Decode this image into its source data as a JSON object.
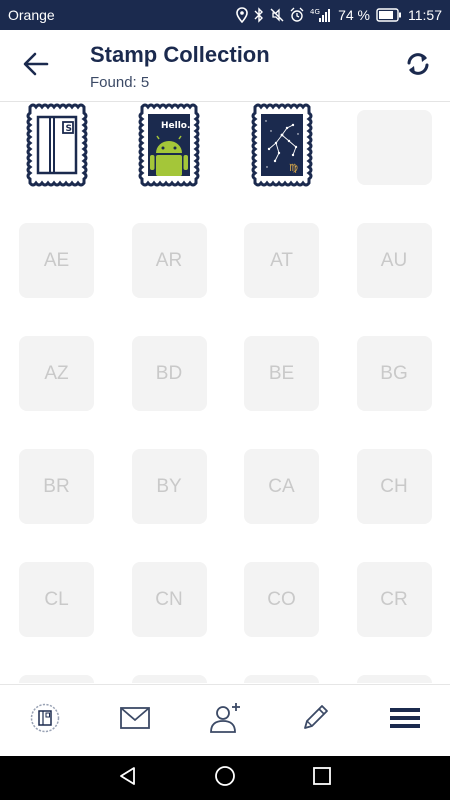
{
  "status_bar": {
    "carrier": "Orange",
    "battery": "74 %",
    "time": "11:57",
    "network": "4G",
    "icons": [
      "location-icon",
      "bluetooth-icon",
      "mute-icon",
      "alarm-icon",
      "signal-icon",
      "battery-icon"
    ]
  },
  "header": {
    "title": "Stamp Collection",
    "subtitle": "Found: 5",
    "back_icon": "arrow-left-icon",
    "refresh_icon": "refresh-icon"
  },
  "stamps_found": [
    {
      "name": "letter-stamp",
      "icon": "letter-s-icon"
    },
    {
      "name": "android-stamp",
      "icon": "android-hello-icon",
      "text": "Hello."
    },
    {
      "name": "constellation-stamp",
      "icon": "virgo-constellation-icon",
      "text": "♍"
    }
  ],
  "country_slots": [
    "AE",
    "AR",
    "AT",
    "AU",
    "AZ",
    "BD",
    "BE",
    "BG",
    "BR",
    "BY",
    "CA",
    "CH",
    "CL",
    "CN",
    "CO",
    "CR"
  ],
  "bottom_nav": [
    {
      "name": "stamps-tab",
      "icon": "stamp-icon"
    },
    {
      "name": "mail-tab",
      "icon": "envelope-icon"
    },
    {
      "name": "add-friend-tab",
      "icon": "add-user-icon"
    },
    {
      "name": "write-tab",
      "icon": "pencil-icon"
    },
    {
      "name": "menu-tab",
      "icon": "hamburger-menu-icon"
    }
  ],
  "colors": {
    "primary": "#1b2a4e",
    "android_green": "#a4c639",
    "slot_bg": "#f3f3f3",
    "slot_text": "#c9c9c9"
  }
}
